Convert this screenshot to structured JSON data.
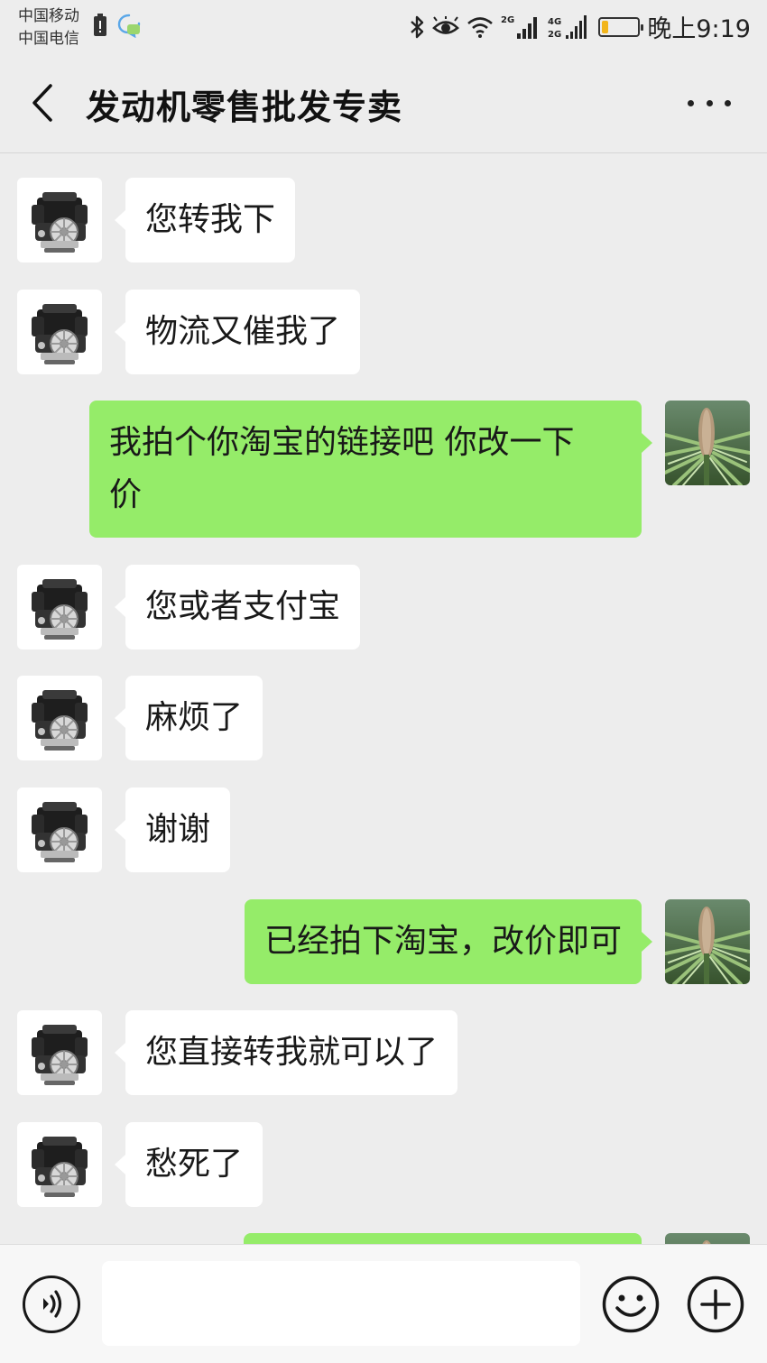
{
  "status_bar": {
    "carrier_1": "中国移动",
    "carrier_2": "中国电信",
    "network_1": "2G",
    "network_2_top": "4G",
    "network_2_bottom": "2G",
    "time": "晚上9:19",
    "battery_level": 0.15,
    "battery_color": "#f2b51b"
  },
  "header": {
    "title": "发动机零售批发专卖"
  },
  "colors": {
    "background": "#ededed",
    "incoming_bubble": "#ffffff",
    "outgoing_bubble": "#95ec69"
  },
  "messages": [
    {
      "side": "left",
      "text": "您转我下",
      "avatar": "engine-avatar"
    },
    {
      "side": "left",
      "text": "物流又催我了",
      "avatar": "engine-avatar"
    },
    {
      "side": "right",
      "line1": "我拍个你淘宝的链接吧 你改一下",
      "line2": "价",
      "avatar": "plant-avatar"
    },
    {
      "side": "left",
      "text": "您或者支付宝",
      "avatar": "engine-avatar"
    },
    {
      "side": "left",
      "text": "麻烦了",
      "avatar": "engine-avatar"
    },
    {
      "side": "left",
      "text": "谢谢",
      "avatar": "engine-avatar"
    },
    {
      "side": "right",
      "text": "已经拍下淘宝，改价即可",
      "avatar": "plant-avatar"
    },
    {
      "side": "left",
      "text": "您直接转我就可以了",
      "avatar": "engine-avatar"
    },
    {
      "side": "left",
      "text": "愁死了",
      "avatar": "engine-avatar"
    },
    {
      "side": "right",
      "text": "",
      "avatar": "plant-avatar"
    }
  ],
  "input": {
    "value": "",
    "icons": [
      "voice-icon",
      "emoji-icon",
      "plus-icon"
    ]
  }
}
